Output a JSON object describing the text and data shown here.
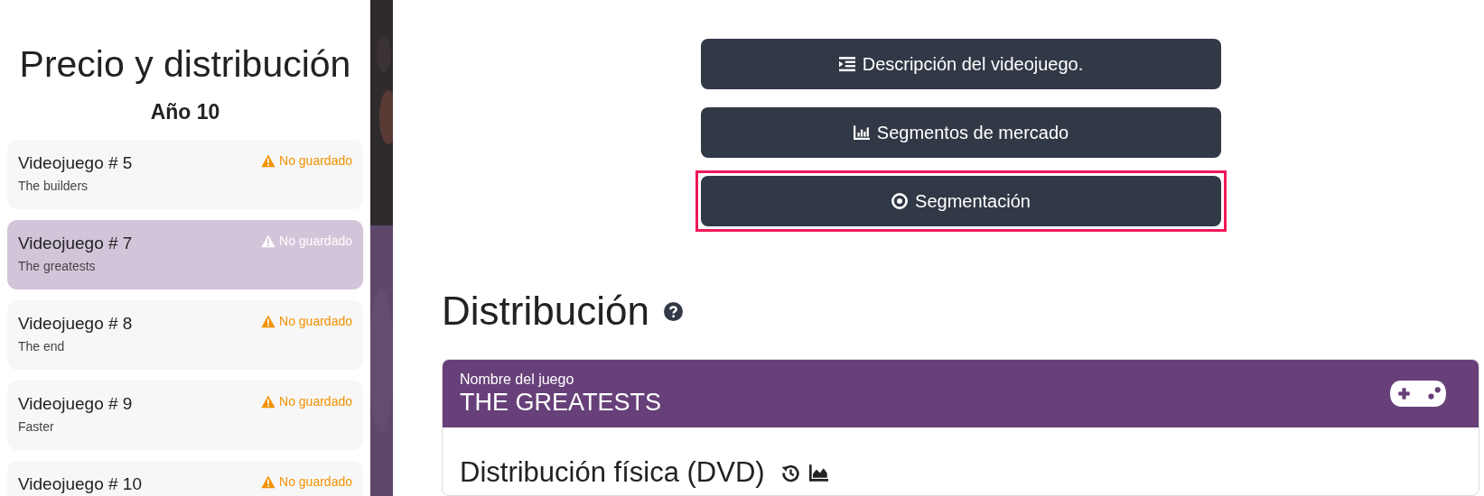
{
  "sidebar": {
    "title": "Precio y distribución",
    "subtitle": "Año 10",
    "items": [
      {
        "name": "Videojuego # 5",
        "subtitle": "The builders",
        "status": "No guardado",
        "selected": false
      },
      {
        "name": "Videojuego # 7",
        "subtitle": "The greatests",
        "status": "No guardado",
        "selected": true
      },
      {
        "name": "Videojuego # 8",
        "subtitle": "The end",
        "status": "No guardado",
        "selected": false
      },
      {
        "name": "Videojuego # 9",
        "subtitle": "Faster",
        "status": "No guardado",
        "selected": false
      },
      {
        "name": "Videojuego # 10",
        "status": "No guardado",
        "selected": false
      }
    ]
  },
  "buttons": [
    {
      "label": "Descripción del videojuego.",
      "kind": "list",
      "highlighted": false
    },
    {
      "label": "Segmentos de mercado",
      "kind": "chart",
      "highlighted": false
    },
    {
      "label": "Segmentación",
      "kind": "target",
      "highlighted": true
    }
  ],
  "section": {
    "title": "Distribución",
    "card": {
      "caption": "Nombre del juego",
      "game": "THE GREATESTS",
      "subsection": "Distribución física (DVD)"
    }
  }
}
